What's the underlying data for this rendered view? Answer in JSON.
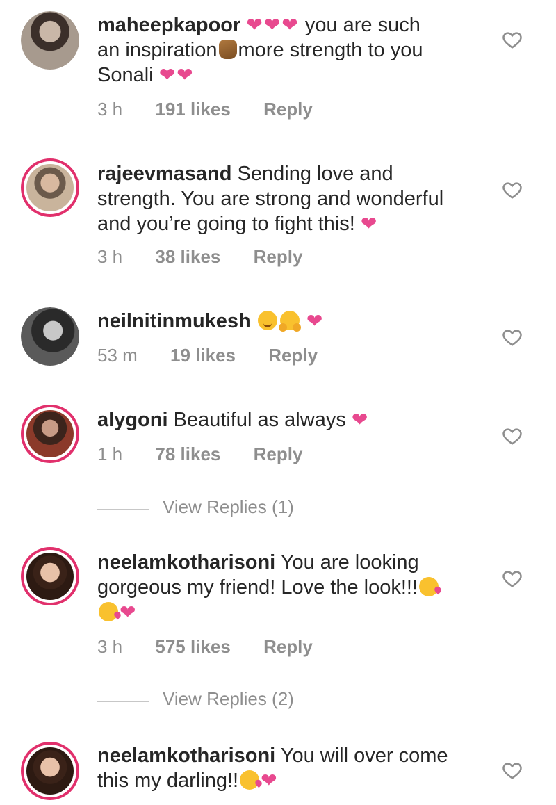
{
  "colors": {
    "text": "#262626",
    "muted": "#8e8e8e",
    "heart": "#e8498f",
    "story_ring": "#e1306c"
  },
  "comments": [
    {
      "username": "maheepkapoor",
      "lines": [
        "you are such",
        "an inspiration",
        "more strength to you",
        "Sonali"
      ],
      "time": "3 h",
      "likes": "191 likes",
      "reply": "Reply"
    },
    {
      "username": "rajeevmasand",
      "lines": [
        "Sending love and",
        "strength. You are strong and wonderful",
        "and you’re going to fight this!"
      ],
      "time": "3 h",
      "likes": "38 likes",
      "reply": "Reply"
    },
    {
      "username": "neilnitinmukesh",
      "lines": [],
      "time": "53 m",
      "likes": "19 likes",
      "reply": "Reply"
    },
    {
      "username": "alygoni",
      "lines": [
        "Beautiful as always"
      ],
      "time": "1 h",
      "likes": "78 likes",
      "reply": "Reply",
      "view_replies": "View Replies (1)"
    },
    {
      "username": "neelamkotharisoni",
      "lines": [
        "You are looking",
        "gorgeous my friend! Love the look!!!"
      ],
      "time": "3 h",
      "likes": "575 likes",
      "reply": "Reply",
      "view_replies": "View Replies (2)"
    },
    {
      "username": "neelamkotharisoni",
      "lines": [
        "You will over come",
        "this my darling!!"
      ]
    }
  ],
  "icons": {
    "like": "heart-outline-icon",
    "heart_emoji": "heart-emoji-icon"
  }
}
